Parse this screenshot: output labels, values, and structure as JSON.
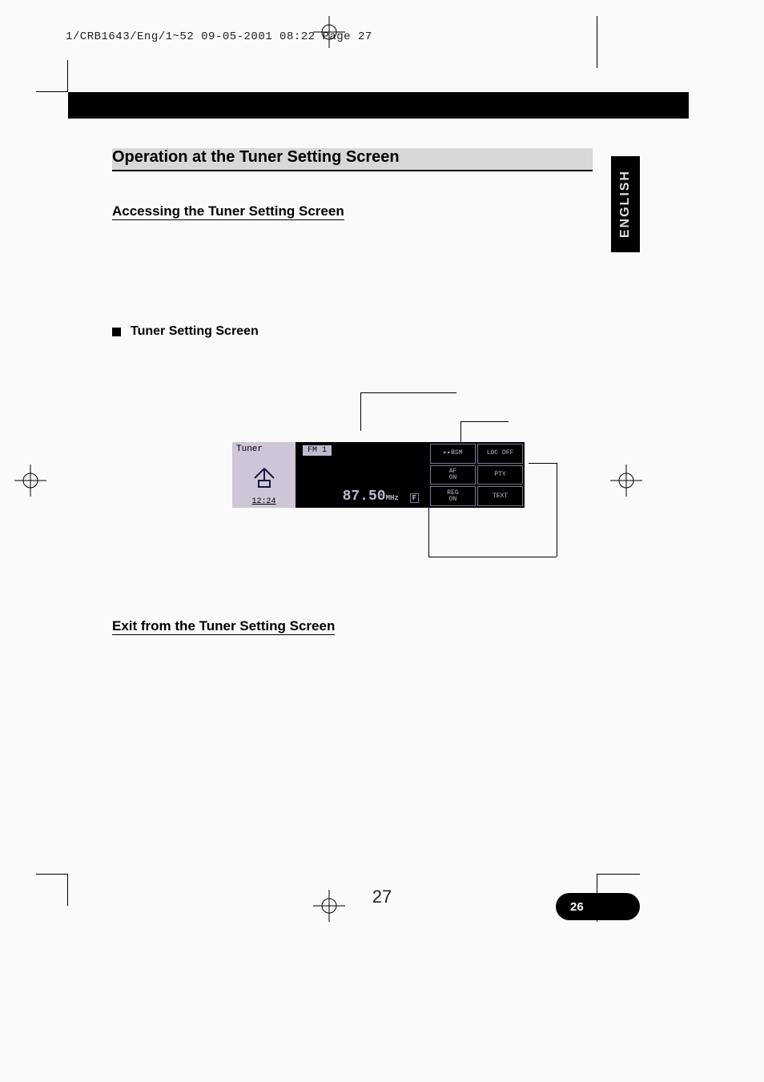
{
  "header_line": "1/CRB1643/Eng/1~52  09-05-2001 08:22  Page 27",
  "language_tab": "ENGLISH",
  "page_number_badge": "26",
  "footer_page": "27",
  "section": {
    "title": "Operation at the Tuner Setting Screen",
    "sub1": "Accessing the Tuner Setting Screen",
    "bullet": "Tuner Setting Screen",
    "sub2": "Exit from the Tuner Setting Screen"
  },
  "tuner": {
    "label": "Tuner",
    "clock": "12:24",
    "band": "FM 1",
    "freq": "87.50",
    "freq_unit": "MHz",
    "f_flag": "F",
    "buttons": {
      "bsm": "▸▸BSM",
      "locoff": "LOC OFF",
      "af": "AF\nON",
      "pty": "PTY",
      "reg": "REG\nON",
      "text": "TEXT"
    }
  }
}
